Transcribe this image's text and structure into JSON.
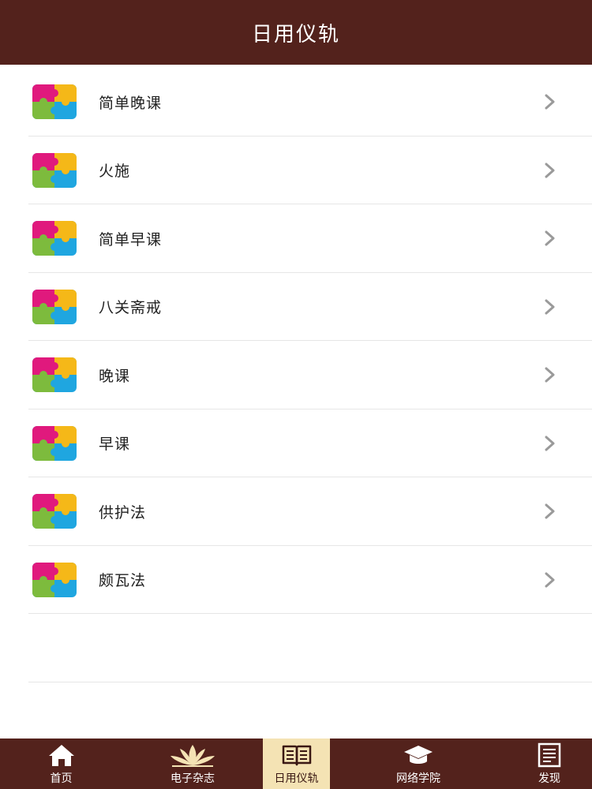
{
  "header": {
    "title": "日用仪轨"
  },
  "list": {
    "items": [
      {
        "label": "简单晚课",
        "icon": "puzzle-icon",
        "chevron": "chevron-right-icon"
      },
      {
        "label": "火施",
        "icon": "puzzle-icon",
        "chevron": "chevron-right-icon"
      },
      {
        "label": "简单早课",
        "icon": "puzzle-icon",
        "chevron": "chevron-right-icon"
      },
      {
        "label": "八关斋戒",
        "icon": "puzzle-icon",
        "chevron": "chevron-right-icon"
      },
      {
        "label": "晚课",
        "icon": "puzzle-icon",
        "chevron": "chevron-right-icon"
      },
      {
        "label": "早课",
        "icon": "puzzle-icon",
        "chevron": "chevron-right-icon"
      },
      {
        "label": "供护法",
        "icon": "puzzle-icon",
        "chevron": "chevron-right-icon"
      },
      {
        "label": "颇瓦法",
        "icon": "puzzle-icon",
        "chevron": "chevron-right-icon"
      }
    ]
  },
  "tabbar": {
    "tabs": [
      {
        "label": "首页",
        "icon": "home-icon",
        "active": false
      },
      {
        "label": "电子杂志",
        "icon": "lotus-icon",
        "active": false
      },
      {
        "label": "日用仪轨",
        "icon": "open-book-icon",
        "active": true
      },
      {
        "label": "网络学院",
        "icon": "graduation-cap-icon",
        "active": false
      },
      {
        "label": "发现",
        "icon": "document-icon",
        "active": false
      }
    ]
  },
  "colors": {
    "header_bg": "#53221c",
    "tabbar_bg": "#53221c",
    "active_tab_bg": "#f4e3b4",
    "divider": "#e6e6e6",
    "chevron": "#9a9a9a",
    "puzzle_magenta": "#e0197d",
    "puzzle_yellow": "#f5b818",
    "puzzle_green": "#7dbb3d",
    "puzzle_blue": "#1fa6e0"
  }
}
